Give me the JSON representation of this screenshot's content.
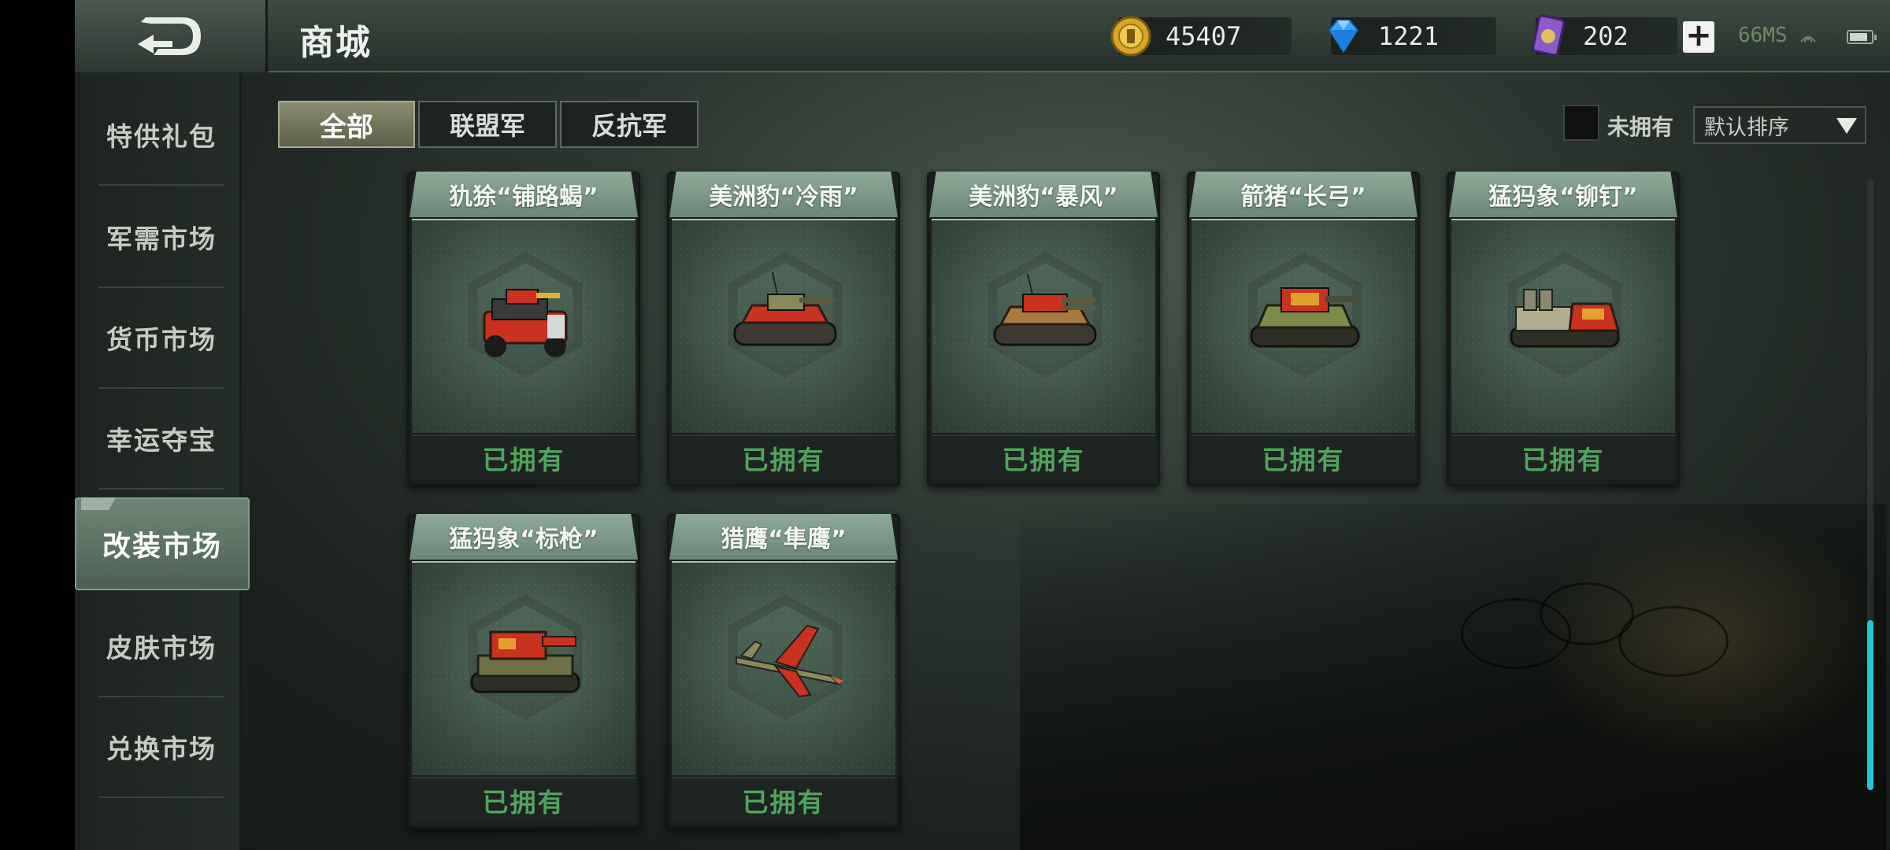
{
  "header": {
    "title": "商城",
    "gold": "45407",
    "diamonds": "1221",
    "cards": "202",
    "ping": "66MS"
  },
  "sidebar": {
    "items": [
      {
        "label": "特供礼包"
      },
      {
        "label": "军需市场"
      },
      {
        "label": "货币市场"
      },
      {
        "label": "幸运夺宝"
      },
      {
        "label": "改装市场",
        "active": true
      },
      {
        "label": "皮肤市场"
      },
      {
        "label": "兑换市场"
      }
    ]
  },
  "tabs": [
    {
      "label": "全部",
      "active": true
    },
    {
      "label": "联盟军"
    },
    {
      "label": "反抗军"
    }
  ],
  "filter": {
    "label": "未拥有",
    "sort": "默认排序"
  },
  "items": [
    {
      "name": "犰狳“铺路蝎”",
      "status": "已拥有",
      "icon": "armored-car-icon"
    },
    {
      "name": "美洲豹“冷雨”",
      "status": "已拥有",
      "icon": "tank-icon"
    },
    {
      "name": "美洲豹“暴风”",
      "status": "已拥有",
      "icon": "tank-icon"
    },
    {
      "name": "箭猪“长弓”",
      "status": "已拥有",
      "icon": "heavy-tank-icon"
    },
    {
      "name": "猛犸象“铆钉”",
      "status": "已拥有",
      "icon": "artillery-icon"
    },
    {
      "name": "猛犸象“标枪”",
      "status": "已拥有",
      "icon": "missile-tank-icon"
    },
    {
      "name": "猎鹰“隼鹰”",
      "status": "已拥有",
      "icon": "jet-fighter-icon"
    }
  ],
  "colors": {
    "owned_text": "#4fa45c",
    "scroll_thumb": "#22c6d6",
    "vehicle_red": "#c8321e"
  }
}
